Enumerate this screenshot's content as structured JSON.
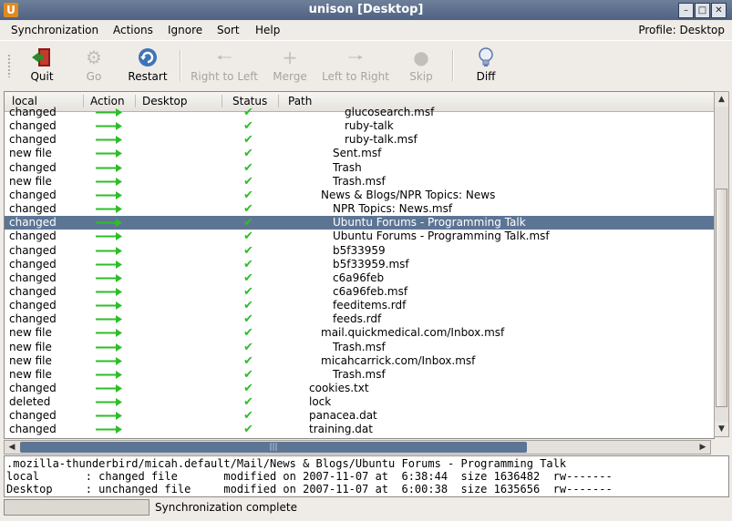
{
  "window": {
    "title": "unison [Desktop]",
    "app_icon": "U"
  },
  "menu": {
    "items": [
      "Synchronization",
      "Actions",
      "Ignore",
      "Sort",
      "Help"
    ],
    "profile": "Profile: Desktop"
  },
  "toolbar": {
    "quit": "Quit",
    "go": "Go",
    "restart": "Restart",
    "right_to_left": "Right to Left",
    "merge": "Merge",
    "left_to_right": "Left to Right",
    "skip": "Skip",
    "diff": "Diff"
  },
  "columns": {
    "local": "local",
    "action": "Action",
    "desktop": "Desktop",
    "status": "Status",
    "path": "Path"
  },
  "rows": [
    {
      "local": "changed",
      "path": "glucosearch.msf",
      "indent": 3
    },
    {
      "local": "changed",
      "path": "ruby-talk",
      "indent": 3
    },
    {
      "local": "changed",
      "path": "ruby-talk.msf",
      "indent": 3
    },
    {
      "local": "new file",
      "path": "Sent.msf",
      "indent": 2
    },
    {
      "local": "changed",
      "path": "Trash",
      "indent": 2
    },
    {
      "local": "new file",
      "path": "Trash.msf",
      "indent": 2
    },
    {
      "local": "changed",
      "path": "News & Blogs/NPR Topics: News",
      "indent": 1
    },
    {
      "local": "changed",
      "path": "NPR Topics: News.msf",
      "indent": 2
    },
    {
      "local": "changed",
      "path": "Ubuntu Forums - Programming Talk",
      "indent": 2,
      "selected": true
    },
    {
      "local": "changed",
      "path": "Ubuntu Forums - Programming Talk.msf",
      "indent": 2
    },
    {
      "local": "changed",
      "path": "b5f33959",
      "indent": 2
    },
    {
      "local": "changed",
      "path": "b5f33959.msf",
      "indent": 2
    },
    {
      "local": "changed",
      "path": "c6a96feb",
      "indent": 2
    },
    {
      "local": "changed",
      "path": "c6a96feb.msf",
      "indent": 2
    },
    {
      "local": "changed",
      "path": "feeditems.rdf",
      "indent": 2
    },
    {
      "local": "changed",
      "path": "feeds.rdf",
      "indent": 2
    },
    {
      "local": "new file",
      "path": "mail.quickmedical.com/Inbox.msf",
      "indent": 1
    },
    {
      "local": "new file",
      "path": "Trash.msf",
      "indent": 2
    },
    {
      "local": "new file",
      "path": "micahcarrick.com/Inbox.msf",
      "indent": 1
    },
    {
      "local": "new file",
      "path": "Trash.msf",
      "indent": 2
    },
    {
      "local": "changed",
      "path": "cookies.txt",
      "indent": 0
    },
    {
      "local": "deleted",
      "path": "lock",
      "indent": 0
    },
    {
      "local": "changed",
      "path": "panacea.dat",
      "indent": 0
    },
    {
      "local": "changed",
      "path": "training.dat",
      "indent": 0
    }
  ],
  "details": {
    "path": ".mozilla-thunderbird/micah.default/Mail/News & Blogs/Ubuntu Forums - Programming Talk",
    "local": "local       : changed file       modified on 2007-11-07 at  6:38:44  size 1636482  rw-------",
    "desktop": "Desktop     : unchanged file     modified on 2007-11-07 at  6:00:38  size 1635656  rw-------"
  },
  "status": "Synchronization complete",
  "colors": {
    "selection": "#5d7595",
    "arrow": "#2fbd2a",
    "titlebar": "#5b6c8a"
  }
}
